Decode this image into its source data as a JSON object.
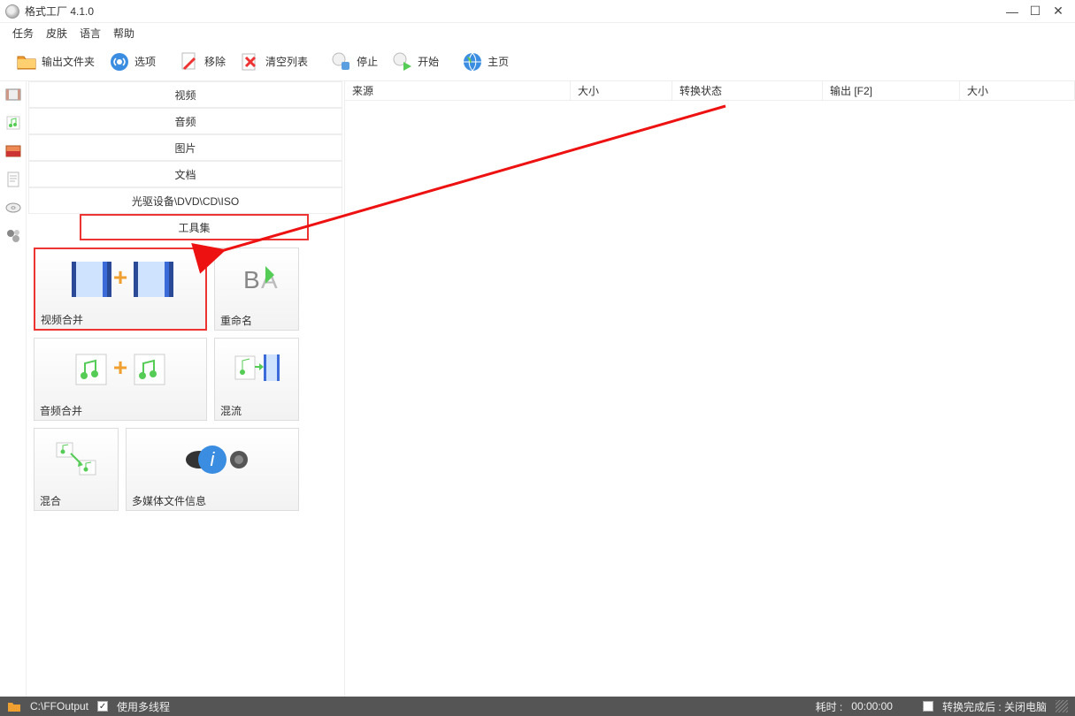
{
  "window": {
    "title": "格式工厂 4.1.0"
  },
  "menu": {
    "task": "任务",
    "skin": "皮肤",
    "language": "语言",
    "help": "帮助"
  },
  "toolbar": {
    "output_folder": "输出文件夹",
    "options": "选项",
    "remove": "移除",
    "clear_list": "清空列表",
    "stop": "停止",
    "start": "开始",
    "homepage": "主页"
  },
  "categories": {
    "video": "视频",
    "audio": "音频",
    "picture": "图片",
    "document": "文档",
    "rom": "光驱设备\\DVD\\CD\\ISO",
    "toolbox": "工具集"
  },
  "tools": {
    "video_joiner": "视频合并",
    "rename": "重命名",
    "audio_joiner": "音频合并",
    "mux": "混流",
    "mix": "混合",
    "media_info": "多媒体文件信息"
  },
  "list_columns": {
    "source": "来源",
    "size": "大小",
    "convert_state": "转换状态",
    "output": "输出 [F2]",
    "size2": "大小"
  },
  "status": {
    "output_path": "C:\\FFOutput",
    "multithread": "使用多线程",
    "elapsed_label": "耗时 :",
    "elapsed_value": "00:00:00",
    "after_convert": "转换完成后 : 关闭电脑"
  }
}
